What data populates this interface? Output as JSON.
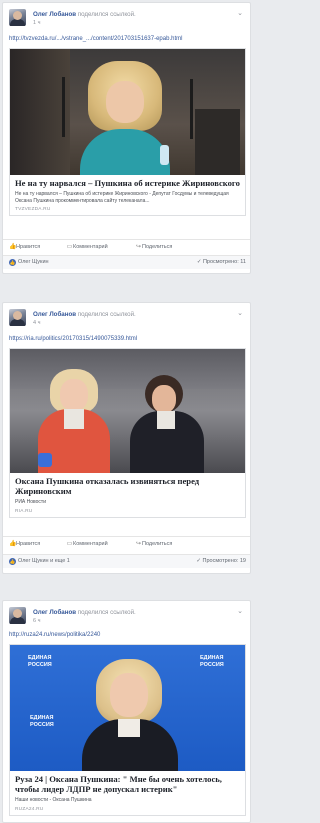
{
  "posts": [
    {
      "author": "Олег Лобанов",
      "action": "поделился ссылкой.",
      "time": "1 ч",
      "url": "http://tvzvezda.ru/.../vstrane_.../content/201703151637-epab.html",
      "card": {
        "title": "Не на ту нарвался – Пушкина об истерике Жириновского",
        "description": "Не на ту нарвался – Пушкина об истерике Жириновского - Депутат Госдумы и телеведущая Оксана Пушкина прокомментировала сайту телеканала...",
        "source": "",
        "domain": "TVZVEZDA.RU"
      },
      "actions": {
        "like": "Нравится",
        "comment": "Комментарий",
        "share": "Поделиться"
      },
      "reactions": "Олег Щукин",
      "views": "Просмотрено: 11"
    },
    {
      "author": "Олег Лобанов",
      "action": "поделился ссылкой.",
      "time": "4 ч",
      "url": "https://ria.ru/politics/20170315/1490075339.html",
      "card": {
        "title": "Оксана Пушкина отказалась извиняться перед Жириновским",
        "description": "",
        "source": "РИА Новости",
        "domain": "RIA.RU"
      },
      "actions": {
        "like": "Нравится",
        "comment": "Комментарий",
        "share": "Поделиться"
      },
      "reactions": "Олег Щукин и еще 1",
      "views": "Просмотрено: 19"
    },
    {
      "author": "Олег Лобанов",
      "action": "поделился ссылкой.",
      "time": "6 ч",
      "url": "http://ruza24.ru/news/politika/2240",
      "card": {
        "title": "Руза 24 | Оксана Пушкина: \" Мне бы очень хотелось, чтобы лидер ЛДПР не допускал истерик\"",
        "description": "",
        "source": "Наши новости - Оксана Пушкина",
        "domain": "RUZA24.RU",
        "banner": "ЕДИНАЯ РОССИЯ"
      }
    }
  ]
}
